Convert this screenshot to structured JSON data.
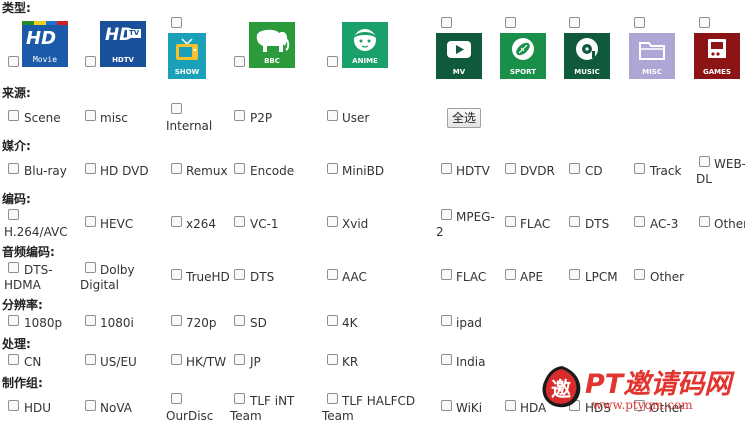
{
  "sections": {
    "type": "类型:",
    "source": "来源:",
    "medium": "媒介:",
    "codec": "编码:",
    "audio": "音频编码:",
    "resolution": "分辨率:",
    "processing": "处理:",
    "team": "制作组:"
  },
  "type_icons": {
    "movie": "Movie",
    "hdtv_top": "HD",
    "hdtv": "HDTV",
    "show": "SHOW",
    "bbc": "BBC",
    "anime": "ANIME",
    "mv": "MV",
    "sport": "SPORT",
    "music": "MUSIC",
    "misc": "MISC",
    "games": "GAMES"
  },
  "source": [
    "Scene",
    "misc",
    "Internal",
    "P2P",
    "User"
  ],
  "select_all": "全选",
  "medium": [
    "Blu-ray",
    "HD DVD",
    "Remux",
    "Encode",
    "MiniBD",
    "HDTV",
    "DVDR",
    "CD",
    "Track",
    "WEB-",
    "DL"
  ],
  "codec": [
    "H.264/AVC",
    "HEVC",
    "x264",
    "VC-1",
    "Xvid",
    "MPEG-",
    "2",
    "FLAC",
    "DTS",
    "AC-3",
    "Other"
  ],
  "audio": [
    "DTS-",
    "HDMA",
    "Dolby",
    "Digital",
    "TrueHD",
    "DTS",
    "AAC",
    "FLAC",
    "APE",
    "LPCM",
    "Other"
  ],
  "resolution": [
    "1080p",
    "1080i",
    "720p",
    "SD",
    "4K",
    "ipad"
  ],
  "processing": [
    "CN",
    "US/EU",
    "HK/TW",
    "JP",
    "KR",
    "India"
  ],
  "team": [
    "HDU",
    "NoVA",
    "OurDisc",
    "TLF iNT",
    "Team",
    "TLF HALFCD",
    "Team",
    "WiKi",
    "HDA",
    "HDS",
    "Other"
  ],
  "watermark": {
    "title": "PT邀请码网",
    "url": "www.ptyqm.com",
    "logo_char": "邀"
  },
  "colors": {
    "bluray_blue": "#1a5aa8",
    "show_teal": "#1aa0b8",
    "bbc_green": "#2a9a3a",
    "anime_green": "#1aa06a",
    "mv_darkgreen": "#11593c",
    "sport_green": "#1a8f4a",
    "music_darkgreen": "#0f5a3c",
    "misc_lilac": "#b0a6d6",
    "games_red": "#8c1414",
    "watermark_red": "#e3352f"
  }
}
